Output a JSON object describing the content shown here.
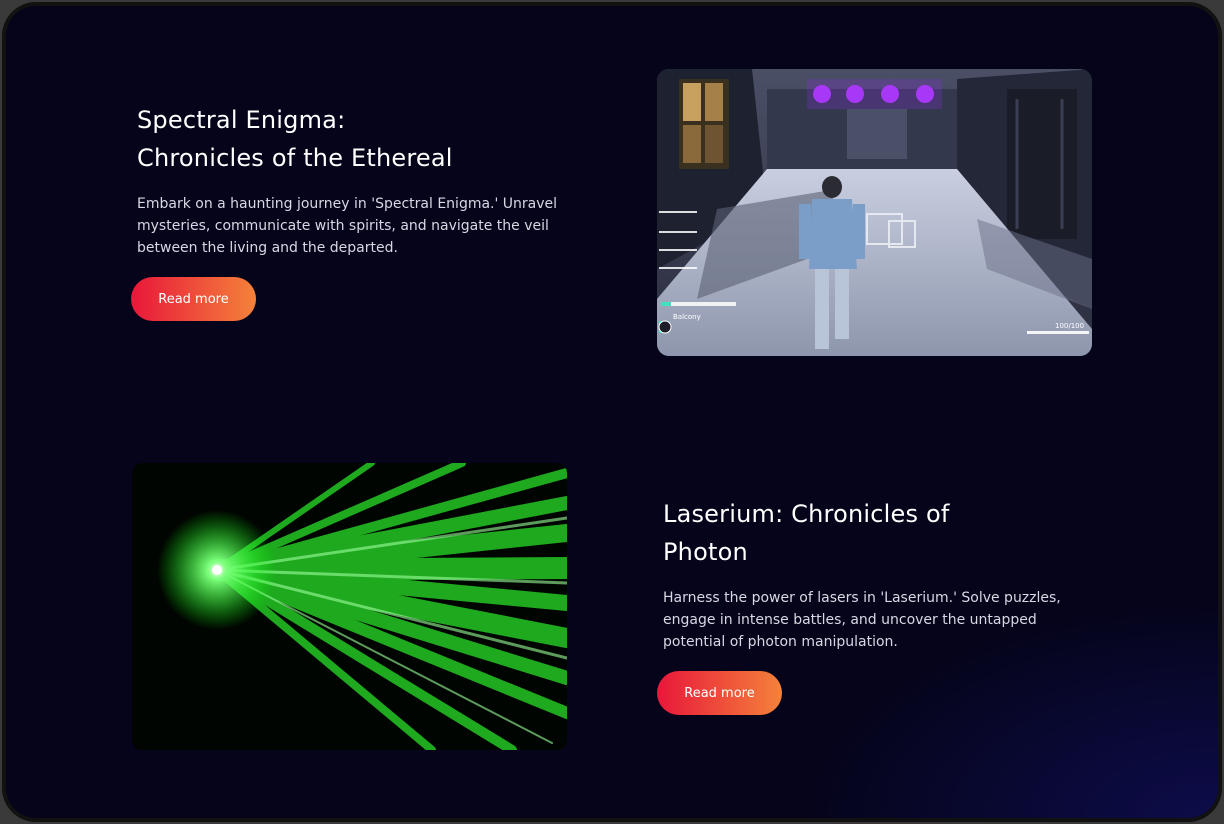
{
  "games": [
    {
      "title_line1": "Spectral Enigma:",
      "title_line2": "Chronicles of the Ethereal",
      "description": "Embark on a haunting journey in 'Spectral Enigma.' Unravel mysteries, communicate with spirits, and navigate the veil between the living and the departed.",
      "button_label": "Read more",
      "hud": {
        "location": "Balcony",
        "health": "100/100"
      }
    },
    {
      "title_line1": "Laserium: Chronicles of",
      "title_line2": "Photon",
      "description": "Harness the power of lasers in 'Laserium.' Solve puzzles, engage in intense battles, and uncover the untapped potential of photon manipulation.",
      "button_label": "Read more"
    }
  ],
  "colors": {
    "background": "#05041a",
    "button_start": "#e8173a",
    "button_end": "#f4823a",
    "laser": "#2aff2a"
  }
}
